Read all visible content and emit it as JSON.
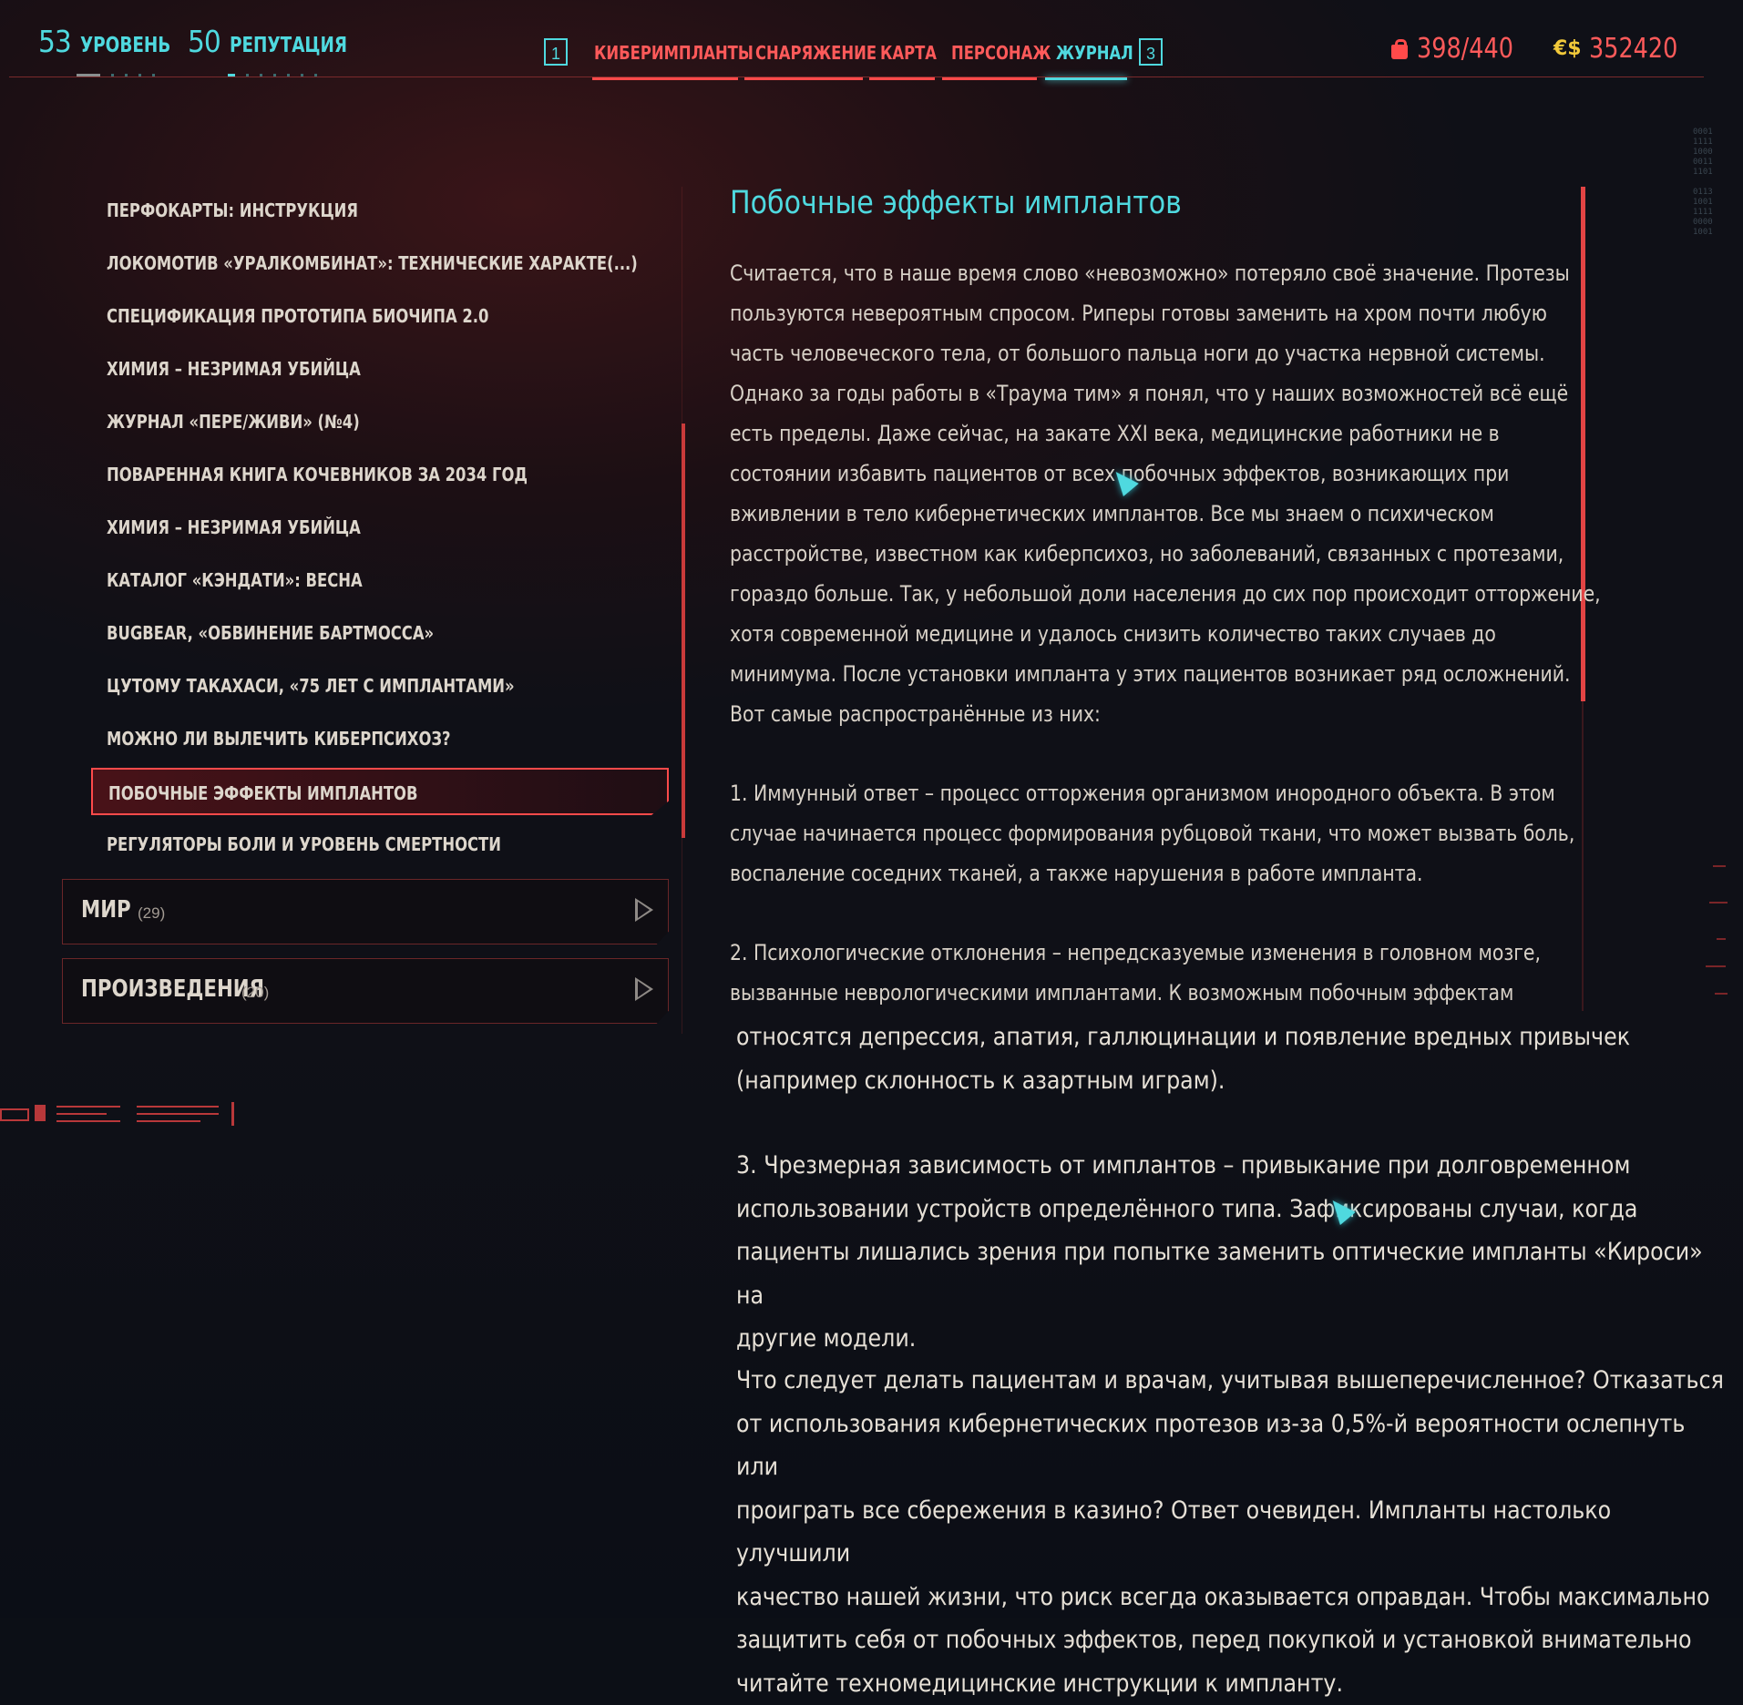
{
  "header": {
    "level": {
      "value": "53",
      "label": "УРОВЕНЬ"
    },
    "reputation": {
      "value": "50",
      "label": "РЕПУТАЦИЯ"
    },
    "key_left": "1",
    "key_right": "3",
    "tabs": [
      {
        "label": "КИБЕРИМПЛАНТЫ",
        "active": false
      },
      {
        "label": "СНАРЯЖЕНИЕ",
        "active": false
      },
      {
        "label": "КАРТА",
        "active": false
      },
      {
        "label": "ПЕРСОНАЖ",
        "active": false
      },
      {
        "label": "ЖУРНАЛ",
        "active": true
      }
    ],
    "carry_weight": "398/440",
    "money_symbol": "€$",
    "money": "352420"
  },
  "colors": {
    "accent_cyan": "#4fd9df",
    "accent_red": "#ff4a4a",
    "money_yellow": "#f2c93a"
  },
  "sidebar": {
    "items": [
      {
        "label": "ПЕРФОКАРТЫ: ИНСТРУКЦИЯ"
      },
      {
        "label": "ЛОКОМОТИВ «УРАЛКОМБИНАТ»: ТЕХНИЧЕСКИЕ ХАРАКТЕ(...)"
      },
      {
        "label": "СПЕЦИФИКАЦИЯ ПРОТОТИПА БИОЧИПА 2.0"
      },
      {
        "label": "ХИМИЯ – НЕЗРИМАЯ УБИЙЦА"
      },
      {
        "label": "ЖУРНАЛ «ПЕРЕ/ЖИВИ» (№4)"
      },
      {
        "label": "ПОВАРЕННАЯ КНИГА КОЧЕВНИКОВ ЗА 2034 ГОД"
      },
      {
        "label": "ХИМИЯ – НЕЗРИМАЯ УБИЙЦА"
      },
      {
        "label": "КАТАЛОГ «КЭНДАТИ»: ВЕСНА"
      },
      {
        "label": "BUGBEAR, «ОБВИНЕНИЕ БАРТМОССА»"
      },
      {
        "label": "ЦУТОМУ ТАКАХАСИ, «75 ЛЕТ С ИМПЛАНТАМИ»"
      },
      {
        "label": "МОЖНО ЛИ ВЫЛЕЧИТЬ КИБЕРПСИХОЗ?"
      },
      {
        "label": "ПОБОЧНЫЕ ЭФФЕКТЫ ИМПЛАНТОВ",
        "selected": true
      },
      {
        "label": "РЕГУЛЯТОРЫ БОЛИ И УРОВЕНЬ СМЕРТНОСТИ"
      }
    ],
    "categories": [
      {
        "name": "МИР",
        "count": "(29)"
      },
      {
        "name": "ПРОИЗВЕДЕНИЯ",
        "count": "(20)"
      }
    ]
  },
  "article": {
    "title": "Побочные эффекты имплантов",
    "p1": [
      "Считается, что в наше время слово «невозможно» потеряло своё значение. Протезы",
      "пользуются невероятным спросом. Риперы готовы заменить на хром почти любую",
      "часть человеческого тела, от большого пальца ноги до участка нервной системы.",
      "Однако за годы работы в «Траума тим» я понял, что у наших возможностей всё ещё",
      "есть пределы. Даже сейчас, на закате XXI века, медицинские работники не в",
      "состоянии избавить пациентов от всех побочных эффектов, возникающих при",
      "вживлении в тело кибернетических имплантов. Все мы знаем о психическом",
      "расстройстве, известном как киберпсихоз, но заболеваний, связанных с протезами,",
      "гораздо больше. Так, у небольшой доли населения до сих пор происходит отторжение,",
      "хотя современной медицине и удалось снизить количество таких случаев до",
      "минимума. После установки импланта у этих пациентов возникает ряд осложнений.",
      "Вот самые распространённые из них:"
    ],
    "p2": [
      "1. Иммунный ответ – процесс отторжения организмом инородного объекта. В этом",
      "случае начинается процесс формирования рубцовой ткани, что может вызвать боль,",
      "воспаление соседних тканей, а также нарушения в работе импланта."
    ],
    "p3": [
      "2. Психологические отклонения – непредсказуемые изменения в головном мозге,",
      "вызванные неврологическими имплантами. К возможным побочным эффектам"
    ],
    "p3_cont": [
      "относятся депрессия, апатия, галлюцинации и появление вредных привычек",
      "(например склонность к азартным играм)."
    ],
    "p4": [
      "3. Чрезмерная зависимость от имплантов – привыкание при долговременном",
      "использовании устройств определённого типа. Зафиксированы случаи, когда",
      "пациенты лишались зрения при попытке заменить оптические импланты «Кироси» на",
      "другие модели."
    ],
    "p5": [
      "Что следует делать пациентам и врачам, учитывая вышеперечисленное? Отказаться",
      "от использования кибернетических протезов из-за 0,5%-й вероятности ослепнуть или",
      "проиграть все сбережения в казино? Ответ очевиден. Импланты настолько улучшили",
      "качество нашей жизни, что риск всегда оказывается оправдан. Чтобы максимально",
      "защитить себя от побочных эффектов, перед покупкой и установкой внимательно",
      "читайте техномедицинские инструкции к импланту."
    ]
  }
}
